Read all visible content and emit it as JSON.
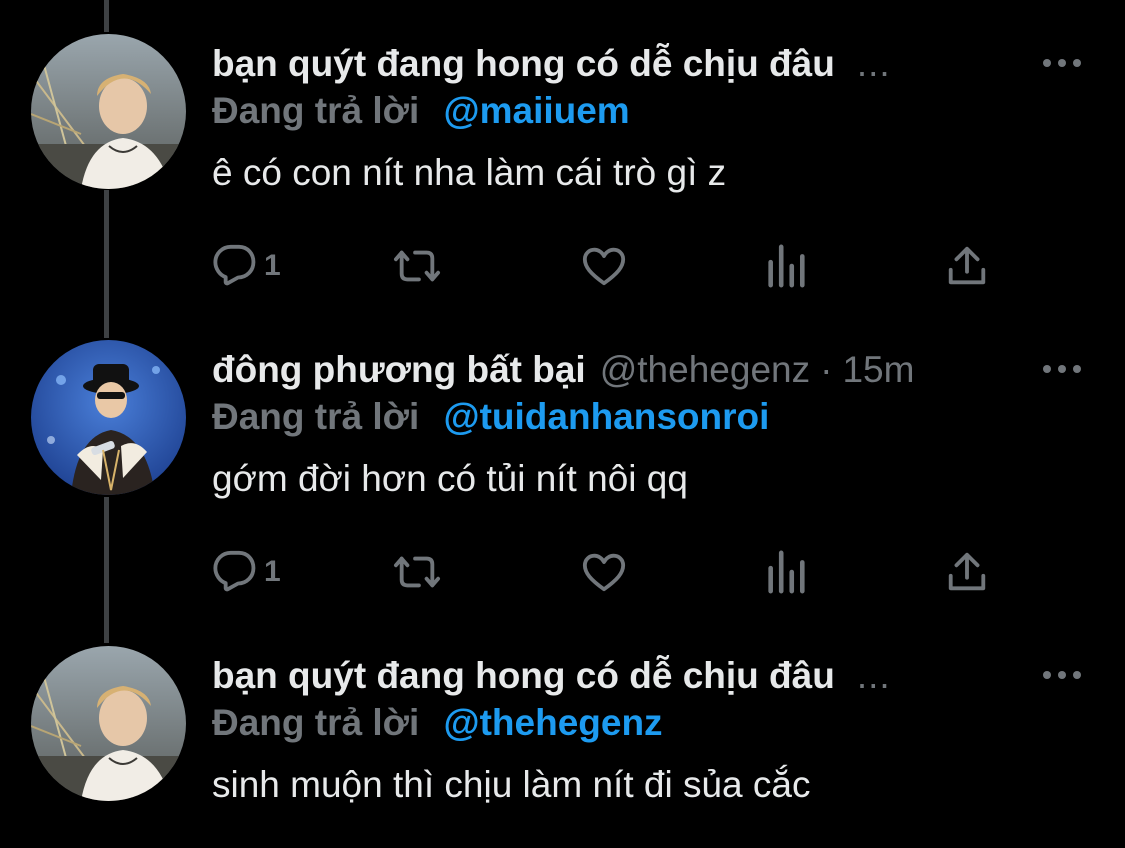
{
  "colors": {
    "background": "#000000",
    "text": "#e7e9ea",
    "muted": "#71767b",
    "link": "#1d9bf0",
    "thread_line": "#3e4144"
  },
  "tweets": [
    {
      "name": "bạn quýt đang hong có dễ chịu đâu",
      "name_truncated": "...",
      "handle": "",
      "time": "",
      "reply_prefix": "Đang trả lời",
      "reply_handle": "@maiiuem",
      "text": "ê có con nít nha làm cái trò gì z",
      "reply_count": "1",
      "avatar": "avatar-user-bridge",
      "actions": [
        "reply-icon",
        "retweet-icon",
        "like-icon",
        "views-icon",
        "share-icon"
      ]
    },
    {
      "name": "đông phương bất bại",
      "name_truncated": "",
      "handle": "@thehegenz",
      "separator": "·",
      "time": "15m",
      "reply_prefix": "Đang trả lời",
      "reply_handle": "@tuidanhansonroi",
      "text": "gớm đời hơn có tủi nít nôi qq",
      "reply_count": "1",
      "avatar": "avatar-user-stage",
      "actions": [
        "reply-icon",
        "retweet-icon",
        "like-icon",
        "views-icon",
        "share-icon"
      ]
    },
    {
      "name": "bạn quýt đang hong có dễ chịu đâu",
      "name_truncated": "...",
      "handle": "",
      "time": "",
      "reply_prefix": "Đang trả lời",
      "reply_handle": "@thehegenz",
      "text": "sinh muộn thì chịu làm nít đi sủa cắc",
      "reply_count": "",
      "avatar": "avatar-user-bridge",
      "actions": []
    }
  ]
}
